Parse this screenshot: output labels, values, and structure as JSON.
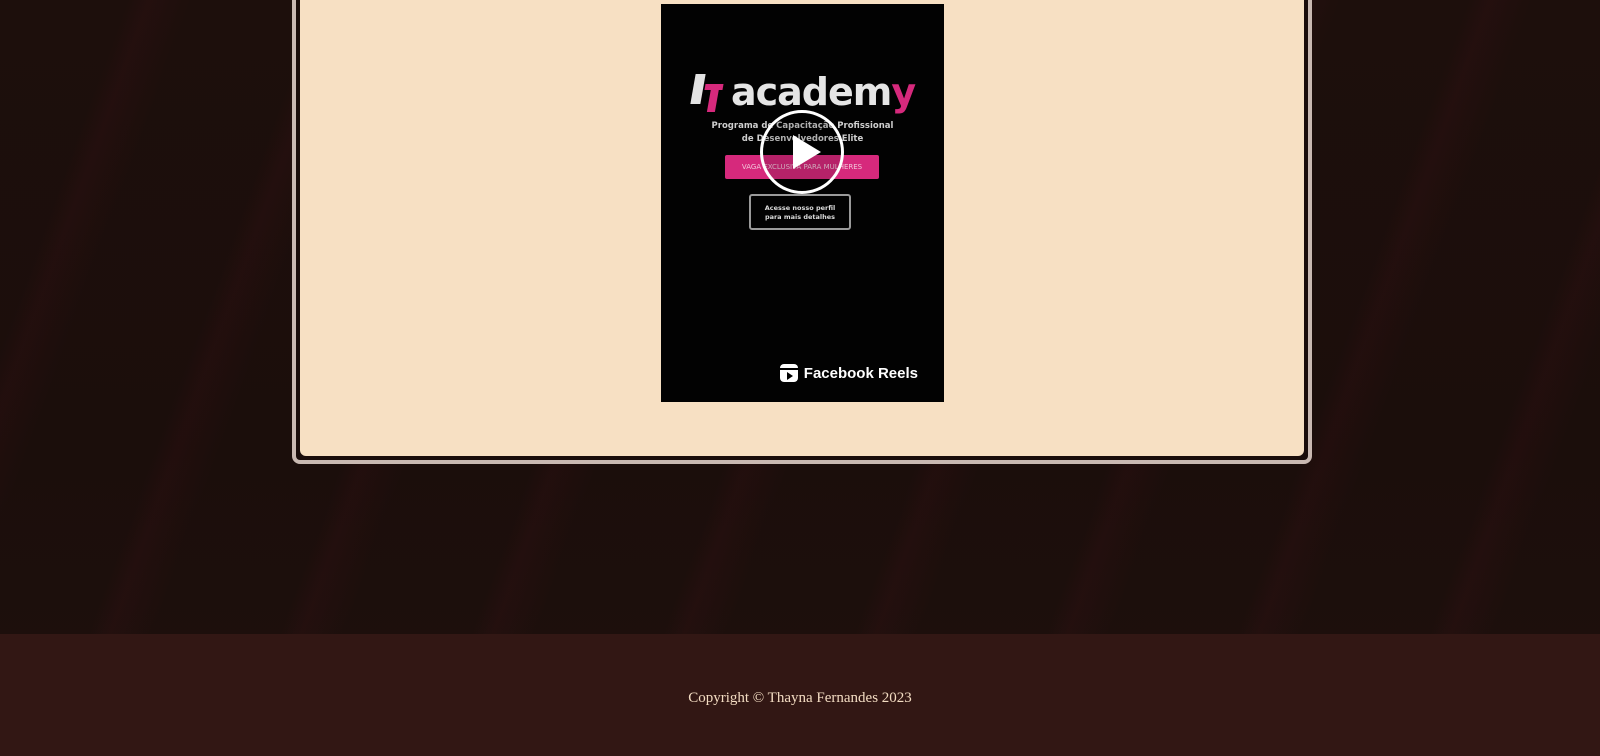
{
  "video": {
    "logo_text": "academy",
    "subtitle_line1": "Programa de Capacitação Profissional",
    "subtitle_line2": "de Desenvolvedores Elite",
    "tag_button": "VAGA EXCLUSIVA PARA MULHERES",
    "profile_button_line1": "Acesse nosso perfil",
    "profile_button_line2": "para mais detalhes",
    "play_icon": "play-icon",
    "platform_icon": "reels-icon",
    "platform_label": "Facebook Reels"
  },
  "footer": {
    "copyright": "Copyright © Thayna Fernandes 2023"
  },
  "colors": {
    "background": "#1d0f0c",
    "card_background": "#f7e0c3",
    "card_border": "#c9b9b2",
    "footer_background": "#321714",
    "footer_text": "#f3dcc2",
    "accent_pink": "#d6297c"
  }
}
